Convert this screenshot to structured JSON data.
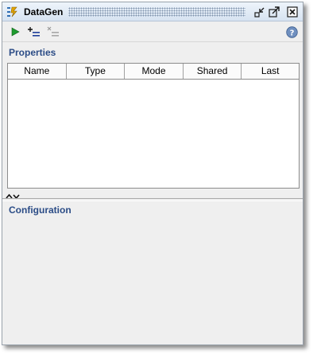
{
  "window": {
    "title": "DataGen",
    "icon": "datagen-app-icon",
    "buttons": [
      "restore-icon",
      "maximize-icon",
      "close-icon"
    ]
  },
  "toolbar": {
    "icons": [
      "run-icon",
      "add-property-icon",
      "remove-property-icon",
      "help-icon"
    ]
  },
  "properties": {
    "title": "Properties",
    "columns": [
      "Name",
      "Type",
      "Mode",
      "Shared",
      "Last"
    ],
    "rows": []
  },
  "configuration": {
    "title": "Configuration"
  },
  "colors": {
    "section_title": "#2b4c86",
    "titlebar_top": "#eef4fb",
    "titlebar_bottom": "#d7e3f1",
    "panel_bg": "#efefef"
  }
}
